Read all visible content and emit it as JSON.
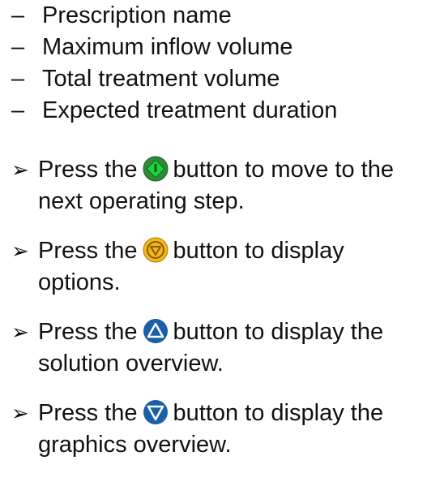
{
  "list_items": [
    {
      "bullet": "–",
      "text": "Prescription name"
    },
    {
      "bullet": "–",
      "text": "Maximum inflow volume"
    },
    {
      "bullet": "–",
      "text": "Total treatment volume"
    },
    {
      "bullet": "–",
      "text": "Expected treatment duration"
    }
  ],
  "instructions": [
    {
      "arrow": "➢",
      "prefix": "Press the",
      "icon": "green-start-button-icon",
      "suffix": "button to move to the",
      "line2": "next operating step."
    },
    {
      "arrow": "➢",
      "prefix": "Press the",
      "icon": "yellow-options-button-icon",
      "suffix": "button to display",
      "line2": "options."
    },
    {
      "arrow": "➢",
      "prefix": "Press the",
      "icon": "blue-up-triangle-button-icon",
      "suffix": "button to display the",
      "line2": "solution overview."
    },
    {
      "arrow": "➢",
      "prefix": "Press the",
      "icon": "blue-down-triangle-button-icon",
      "suffix": "button to display the",
      "line2": "graphics overview."
    }
  ],
  "colors": {
    "green_button": "#2f8a3a",
    "green_accent": "#1fd13a",
    "yellow_button": "#f0b81a",
    "yellow_accent": "#b07a00",
    "blue_button": "#1a5fa8"
  }
}
